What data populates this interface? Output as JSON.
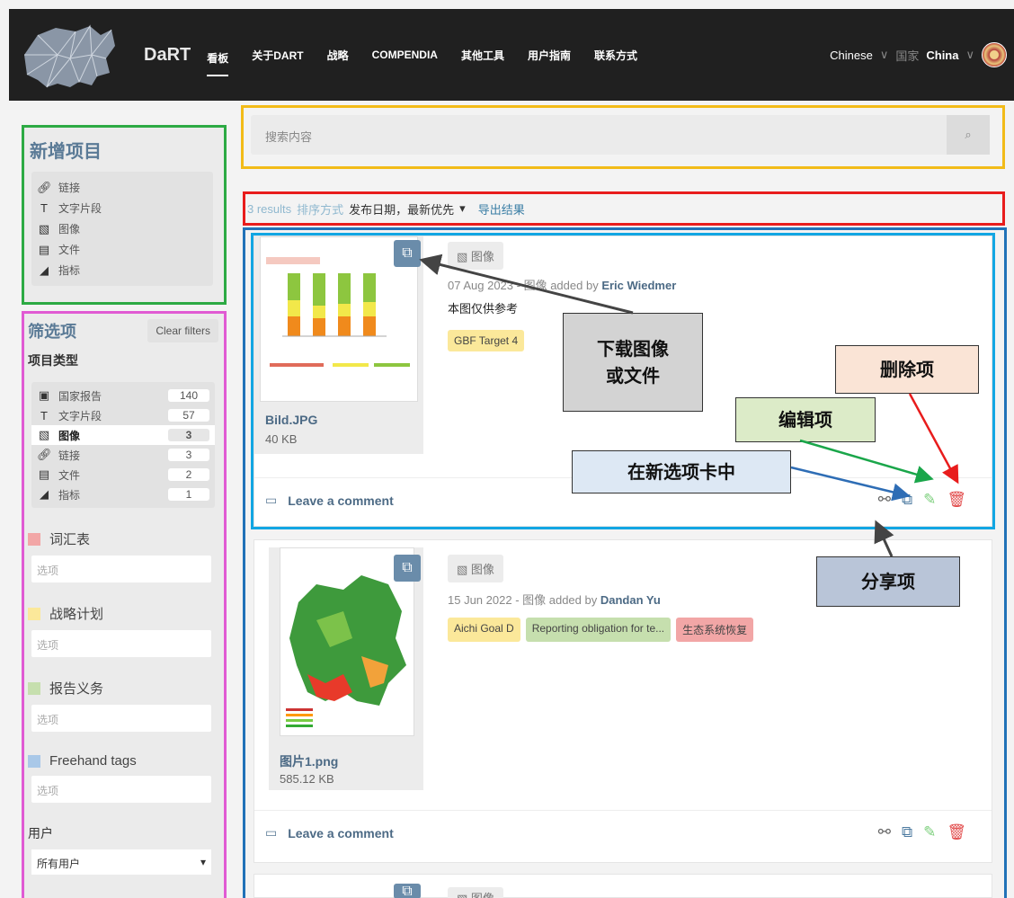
{
  "header": {
    "brand": "DaRT",
    "nav": [
      "看板",
      "关于DART",
      "战略",
      "COMPENDIA",
      "其他工具",
      "用户指南",
      "联系方式"
    ],
    "language": "Chinese",
    "country_label": "国家",
    "country": "China"
  },
  "add_panel": {
    "title": "新增项目",
    "items": [
      {
        "icon": "link-icon",
        "label": "链接"
      },
      {
        "icon": "text-icon",
        "label": "文字片段"
      },
      {
        "icon": "image-icon",
        "label": "图像"
      },
      {
        "icon": "file-icon",
        "label": "文件"
      },
      {
        "icon": "indicator-icon",
        "label": "指标"
      }
    ]
  },
  "filter_panel": {
    "title": "筛选项",
    "clear_label": "Clear filters",
    "type_title": "项目类型",
    "types": [
      {
        "icon": "report-icon",
        "label": "国家报告",
        "count": "140"
      },
      {
        "icon": "text-icon",
        "label": "文字片段",
        "count": "57"
      },
      {
        "icon": "image-icon",
        "label": "图像",
        "count": "3"
      },
      {
        "icon": "link-icon",
        "label": "链接",
        "count": "3"
      },
      {
        "icon": "file-icon",
        "label": "文件",
        "count": "2"
      },
      {
        "icon": "indicator-icon",
        "label": "指标",
        "count": "1"
      }
    ],
    "groups": [
      {
        "label": "词汇表",
        "color": "#f2a6a6",
        "placeholder": "选项"
      },
      {
        "label": "战略计划",
        "color": "#fbe89a",
        "placeholder": "选项"
      },
      {
        "label": "报告义务",
        "color": "#c6dfae",
        "placeholder": "选项"
      },
      {
        "label": "Freehand tags",
        "color": "#a9c8e8",
        "placeholder": "选项"
      }
    ],
    "user_label": "用户",
    "user_value": "所有用户"
  },
  "search": {
    "placeholder": "搜索内容"
  },
  "results": {
    "count": "3 results",
    "sort_label": "排序方式",
    "sort_value": "发布日期，最新优先",
    "export": "导出结果"
  },
  "items": [
    {
      "type": "图像",
      "date": "07 Aug 2023",
      "added_by_text": " - 图像 added by ",
      "author": "Eric Wiedmer",
      "description": "本图仅供参考",
      "tags": [
        {
          "label": "GBF Target 4",
          "color": "#fbe89a"
        }
      ],
      "filename": "Bild.JPG",
      "filesize": "40 KB",
      "comment": "Leave a comment"
    },
    {
      "type": "图像",
      "date": "15 Jun 2022",
      "added_by_text": " - 图像 added by ",
      "author": "Dandan Yu",
      "description": "",
      "tags": [
        {
          "label": "Aichi Goal D",
          "color": "#fbe89a"
        },
        {
          "label": "Reporting obligation for te...",
          "color": "#c6dfae"
        },
        {
          "label": "生态系统恢复",
          "color": "#f2a6a6"
        }
      ],
      "filename": "图片1.png",
      "filesize": "585.12 KB",
      "comment": "Leave a comment"
    },
    {
      "type": "图像"
    }
  ],
  "annotations": {
    "download": "下载图像\n或文件",
    "delete": "删除项",
    "edit": "编辑项",
    "new_tab": "在新选项卡中",
    "share": "分享项"
  },
  "colors": {
    "add_border": "#2daa44",
    "filter_border": "#e05bd3",
    "search_border": "#f2bb18",
    "results_border": "#e81c1c",
    "items_border": "#2172b8",
    "card_border": "#12a6e3"
  }
}
